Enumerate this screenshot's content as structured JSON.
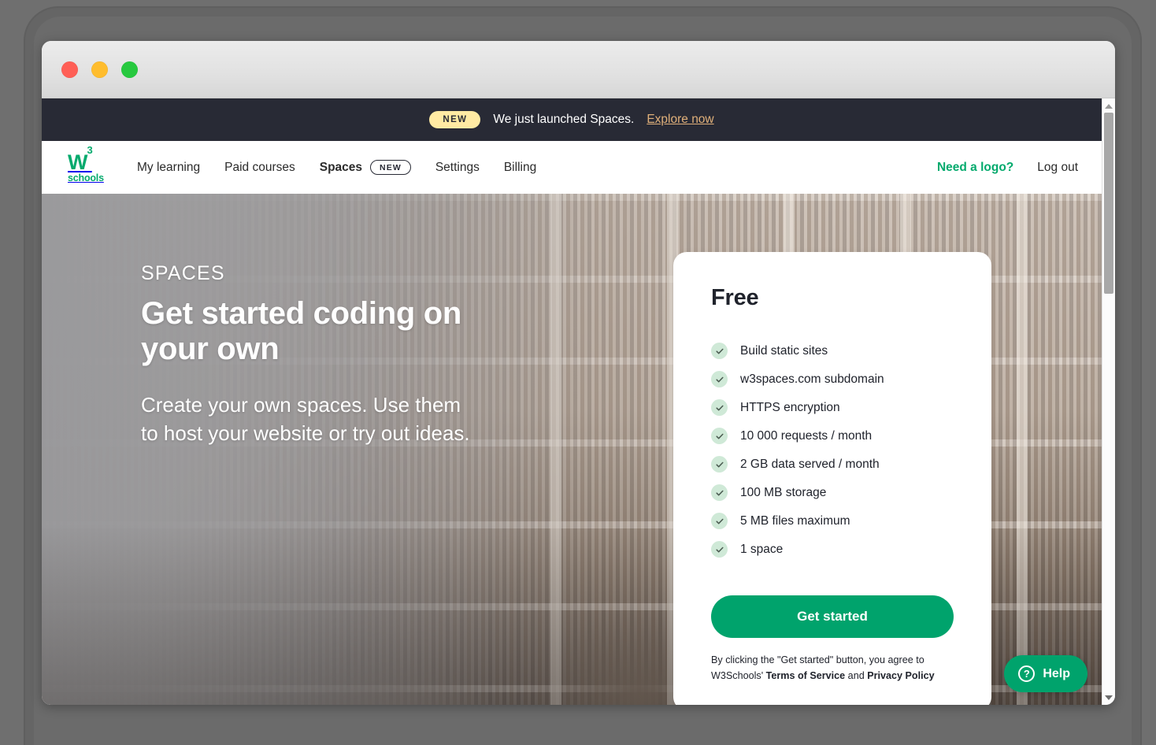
{
  "window": {
    "traffic_lights": [
      {
        "name": "close-button",
        "color": "#ff5f56"
      },
      {
        "name": "minimize-button",
        "color": "#ffbd2e"
      },
      {
        "name": "maximize-button",
        "color": "#27c93f"
      }
    ]
  },
  "announcement": {
    "badge": "NEW",
    "text": "We just launched Spaces.",
    "link": "Explore now"
  },
  "nav": {
    "logo": {
      "mark": "W",
      "sup": "3",
      "sub": "schools"
    },
    "links": [
      {
        "label": "My learning",
        "active": false,
        "badge": null
      },
      {
        "label": "Paid courses",
        "active": false,
        "badge": null
      },
      {
        "label": "Spaces",
        "active": true,
        "badge": "NEW"
      },
      {
        "label": "Settings",
        "active": false,
        "badge": null
      },
      {
        "label": "Billing",
        "active": false,
        "badge": null
      }
    ],
    "logo_cta": "Need a logo?",
    "logout": "Log out"
  },
  "hero": {
    "eyebrow": "SPACES",
    "heading": "Get started coding on your own",
    "subtext": "Create your own spaces. Use them to host your website or try out ideas."
  },
  "card": {
    "plan_title": "Free",
    "features": [
      "Build static sites",
      "w3spaces.com subdomain",
      "HTTPS encryption",
      "10 000 requests / month",
      "2 GB data served / month",
      "100 MB storage",
      "5 MB files maximum",
      "1 space"
    ],
    "cta": "Get started",
    "disclaimer_pre": "By clicking the \"Get started\" button, you agree to W3Schools' ",
    "disclaimer_terms": "Terms of Service",
    "disclaimer_mid": " and ",
    "disclaimer_privacy": "Privacy Policy"
  },
  "help": {
    "label": "Help",
    "icon": "?"
  },
  "colors": {
    "brand_green": "#04aa6d",
    "button_green": "#00a36c",
    "announce_bg": "#282a35",
    "badge_yellow": "#ffeaa3",
    "explore_link": "#e0b07a",
    "check_bg": "#cfe9d7"
  }
}
